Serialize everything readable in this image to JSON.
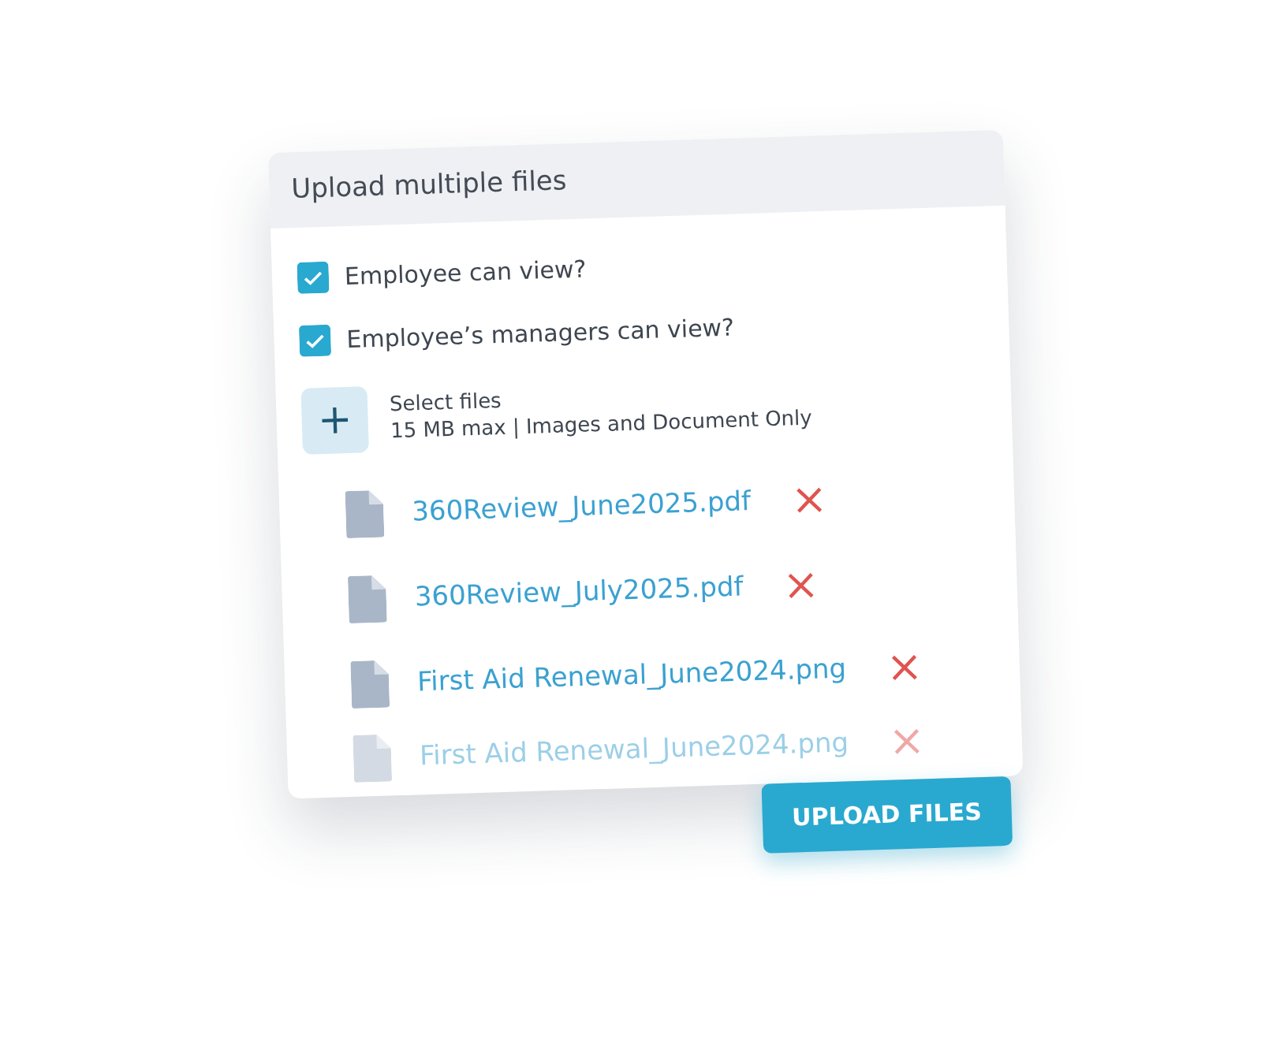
{
  "dialog": {
    "title": "Upload multiple files"
  },
  "options": [
    {
      "label": "Employee can view?",
      "checked": true
    },
    {
      "label": "Employee’s managers can view?",
      "checked": true
    }
  ],
  "picker": {
    "icon": "+",
    "label": "Select files",
    "hint": "15 MB max | Images and Document Only"
  },
  "files": [
    {
      "name": "360Review_June2025.pdf",
      "faded": false
    },
    {
      "name": "360Review_July2025.pdf",
      "faded": false
    },
    {
      "name": "First Aid Renewal_June2024.png",
      "faded": false
    },
    {
      "name": "First Aid Renewal_June2024.png",
      "faded": true
    }
  ],
  "upload_button": "UPLOAD FILES"
}
